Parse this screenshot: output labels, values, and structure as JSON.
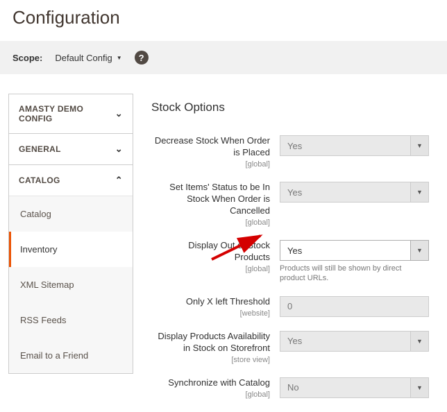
{
  "page_title": "Configuration",
  "scope": {
    "label": "Scope:",
    "value": "Default Config"
  },
  "sidebar": {
    "groups": [
      {
        "label": "AMASTY DEMO CONFIG",
        "expanded": false
      },
      {
        "label": "GENERAL",
        "expanded": false
      },
      {
        "label": "CATALOG",
        "expanded": true,
        "items": [
          {
            "label": "Catalog",
            "active": false
          },
          {
            "label": "Inventory",
            "active": true
          },
          {
            "label": "XML Sitemap",
            "active": false
          },
          {
            "label": "RSS Feeds",
            "active": false
          },
          {
            "label": "Email to a Friend",
            "active": false
          }
        ]
      }
    ]
  },
  "section_title": "Stock Options",
  "fields": [
    {
      "label": "Decrease Stock When Order is Placed",
      "scope": "[global]",
      "value": "Yes",
      "disabled": true
    },
    {
      "label": "Set Items' Status to be In Stock When Order is Cancelled",
      "scope": "[global]",
      "value": "Yes",
      "disabled": true
    },
    {
      "label": "Display Out of Stock Products",
      "scope": "[global]",
      "value": "Yes",
      "disabled": false,
      "note": "Products will still be shown by direct product URLs."
    },
    {
      "label": "Only X left Threshold",
      "scope": "[website]",
      "value": "0",
      "disabled": true
    },
    {
      "label": "Display Products Availability in Stock on Storefront",
      "scope": "[store view]",
      "value": "Yes",
      "disabled": true
    },
    {
      "label": "Synchronize with Catalog",
      "scope": "[global]",
      "value": "No",
      "disabled": true
    }
  ]
}
